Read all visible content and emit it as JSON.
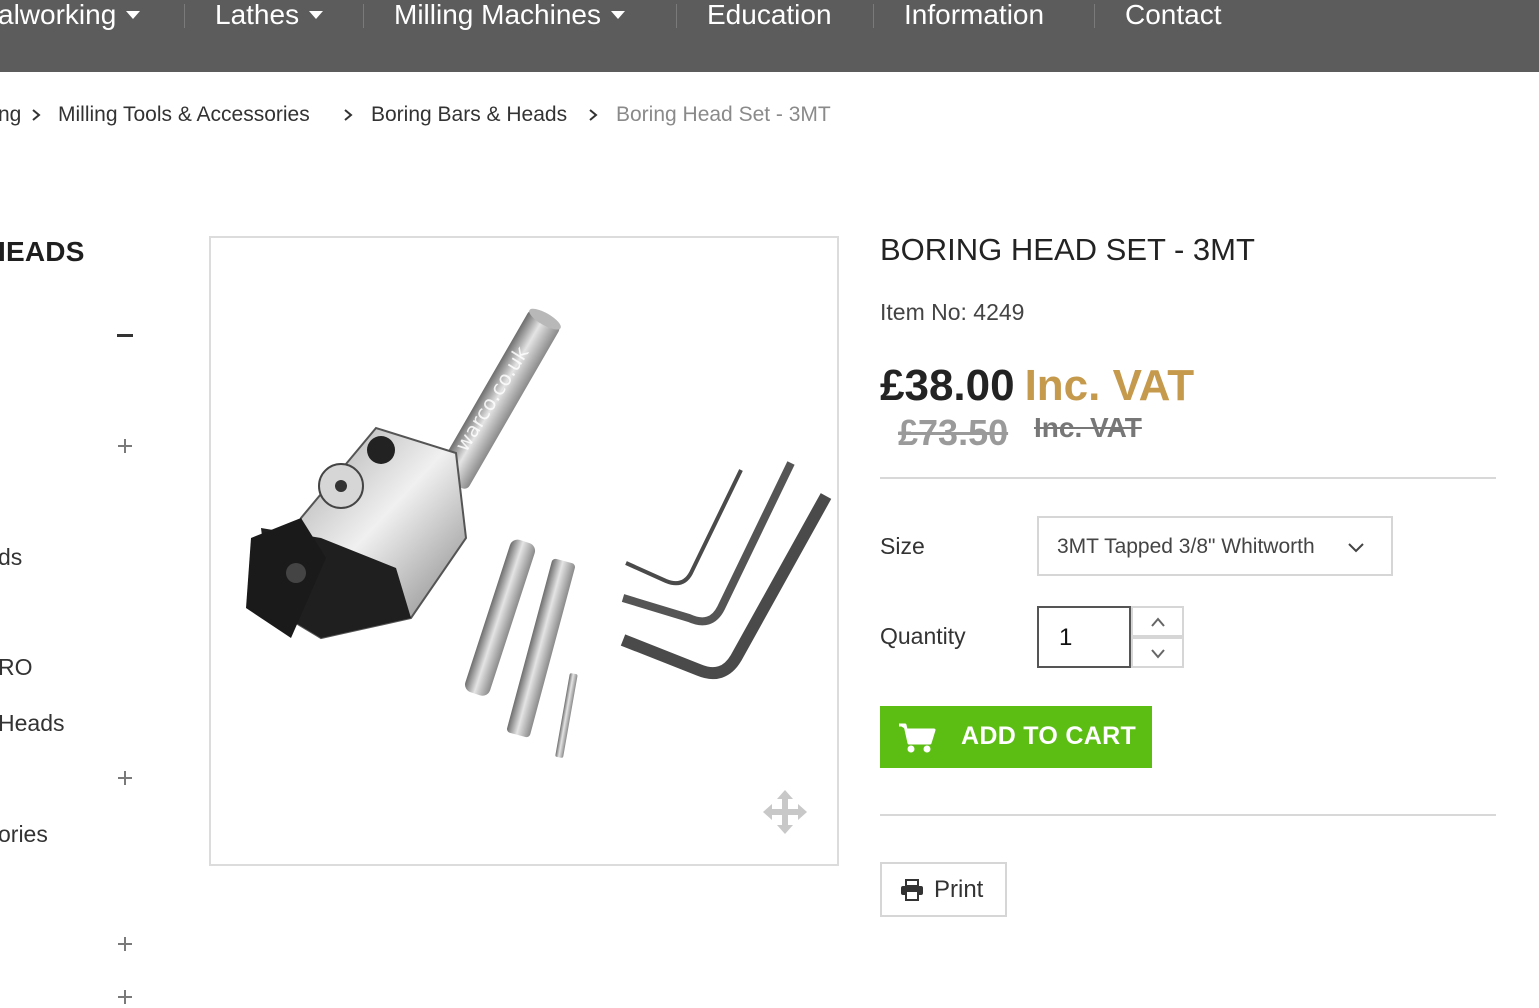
{
  "nav": {
    "items": [
      {
        "label": "alworking",
        "dropdown": true
      },
      {
        "label": "Lathes",
        "dropdown": true
      },
      {
        "label": "Milling Machines",
        "dropdown": true
      },
      {
        "label": "Education",
        "dropdown": false
      },
      {
        "label": "Information",
        "dropdown": false
      },
      {
        "label": "Contact",
        "dropdown": false
      }
    ],
    "bg_color": "#5c5c5c"
  },
  "breadcrumb": [
    "ng",
    "Milling Tools & Accessories",
    "Boring Bars & Heads",
    "Boring Head Set - 3MT"
  ],
  "sidebar": {
    "title": "IEADS",
    "items": [
      "ds",
      "RO",
      "Heads",
      "ories"
    ],
    "toggles": [
      "minus",
      "plus",
      "plus",
      "plus",
      "plus"
    ]
  },
  "product": {
    "title": "BORING HEAD SET - 3MT",
    "item_no": "Item No: 4249",
    "image_watermark": "warco.co.uk",
    "price": "£38.00",
    "price_vat": "Inc. VAT",
    "old_price": "£73.50",
    "old_price_vat": "Inc. VAT",
    "size_label": "Size",
    "size_value": "3MT Tapped 3/8\" Whitworth",
    "quantity_label": "Quantity",
    "quantity_value": "1",
    "add_to_cart": "ADD TO CART",
    "print": "Print"
  },
  "colors": {
    "accent_green": "#5cbd13",
    "vat_gold": "#c69a4c"
  },
  "icons": [
    "chevron-down-icon",
    "chevron-right-icon",
    "cart-icon",
    "printer-icon",
    "expand-icon",
    "plus-icon",
    "minus-icon"
  ]
}
